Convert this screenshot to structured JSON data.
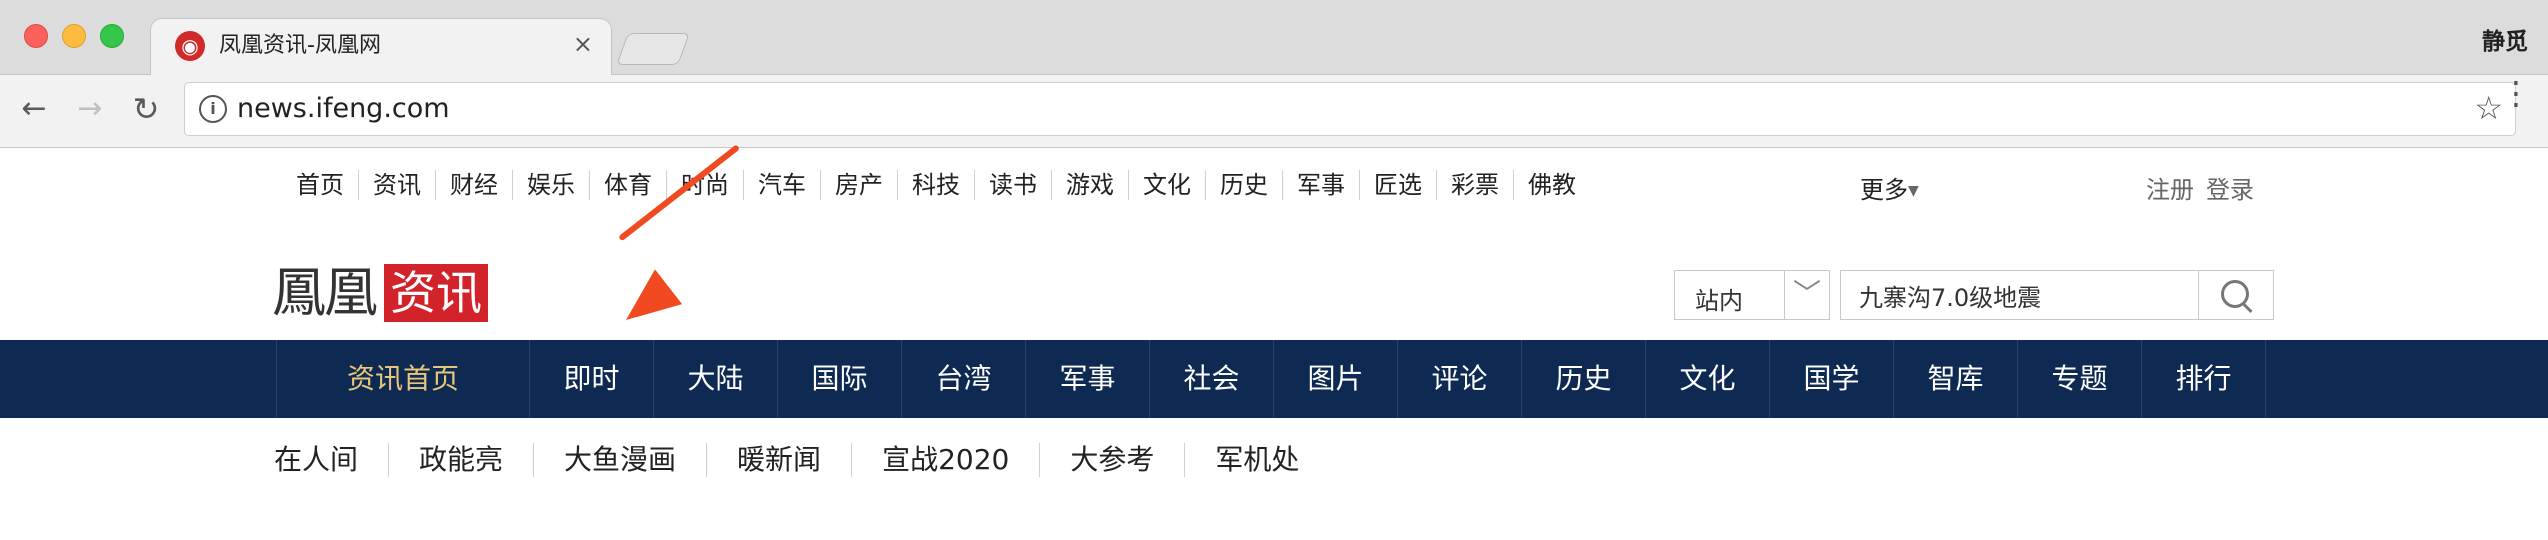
{
  "browser": {
    "tab_title": "凤凰资讯-凤凰网",
    "tab_close": "×",
    "profile_name": "静觅",
    "url": "news.ifeng.com"
  },
  "topnav": {
    "items": [
      "首页",
      "资讯",
      "财经",
      "娱乐",
      "体育",
      "时尚",
      "汽车",
      "房产",
      "科技",
      "读书",
      "游戏",
      "文化",
      "历史",
      "军事",
      "匠选",
      "彩票",
      "佛教"
    ],
    "more": "更多",
    "register": "注册",
    "login": "登录"
  },
  "logo": {
    "brand": "鳳凰",
    "section": "资讯"
  },
  "search": {
    "scope": "站内",
    "query": "九寨沟7.0级地震"
  },
  "mainnav": {
    "items": [
      "资讯首页",
      "即时",
      "大陆",
      "国际",
      "台湾",
      "军事",
      "社会",
      "图片",
      "评论",
      "历史",
      "文化",
      "国学",
      "智库",
      "专题",
      "排行"
    ]
  },
  "subnav": {
    "items": [
      "在人间",
      "政能亮",
      "大鱼漫画",
      "暖新闻",
      "宣战2020",
      "大参考",
      "军机处"
    ]
  },
  "colors": {
    "mainnav_bg": "#0f2a52",
    "mainnav_home_text": "#e8c67a",
    "logo_red": "#d2232a",
    "annotation_arrow": "#f14a21"
  }
}
